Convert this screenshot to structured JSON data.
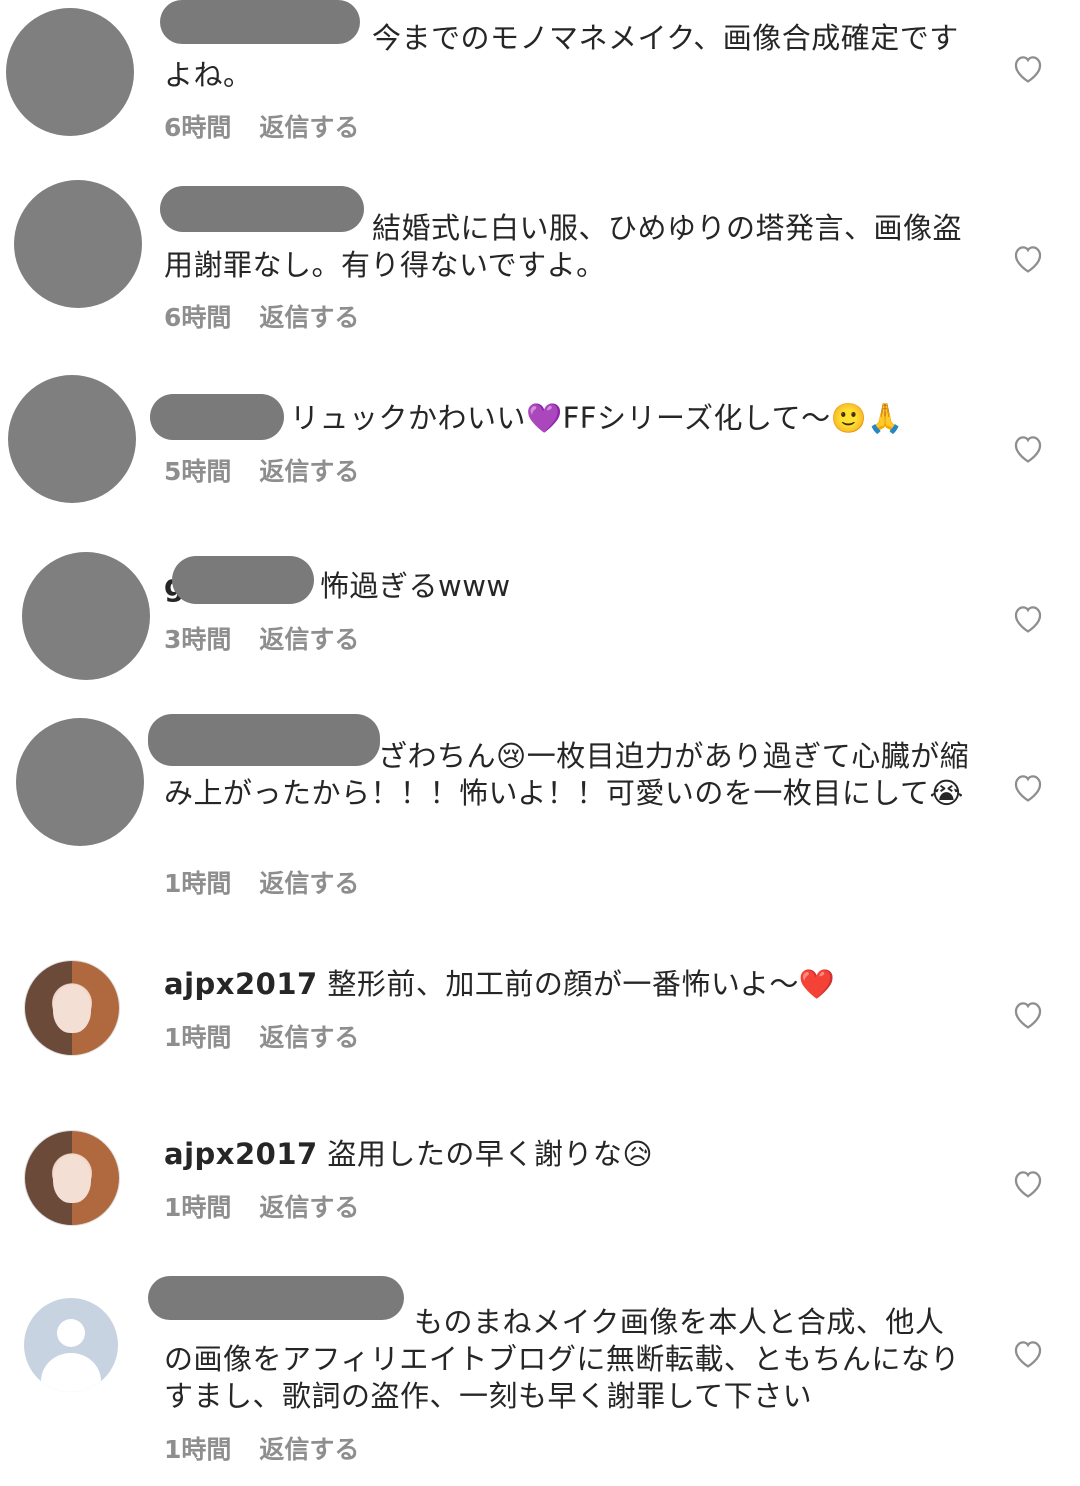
{
  "comments": [
    {
      "username": "",
      "text": "今までのモノマネメイク、画像合成確定ですよね。",
      "time": "6時間",
      "reply": "返信する"
    },
    {
      "username": "",
      "text": "結婚式に白い服、ひめゆりの塔発言、画像盗用謝罪なし。有り得ないですよ。",
      "time": "6時間",
      "reply": "返信する"
    },
    {
      "username": "",
      "text": "リュックかわいい💜FFシリーズ化して〜🙂🙏",
      "time": "5時間",
      "reply": "返信する"
    },
    {
      "username": "g",
      "text": "怖過ぎるwww",
      "time": "3時間",
      "reply": "返信する"
    },
    {
      "username": "",
      "text": "ざわちん😢一枚目迫力があり過ぎて心臓が縮み上がったから！！！怖いよ！！可愛いのを一枚目にして😭",
      "time": "1時間",
      "reply": "返信する"
    },
    {
      "username": "ajpx2017",
      "text": "整形前、加工前の顔が一番怖いよ〜❤️",
      "time": "1時間",
      "reply": "返信する"
    },
    {
      "username": "ajpx2017",
      "text": "盗用したの早く謝りな😥",
      "time": "1時間",
      "reply": "返信する"
    },
    {
      "username": "",
      "text": "ものまねメイク画像を本人と合成、他人の画像をアフィリエイトブログに無断転載、ともちんになりすまし、歌詞の盗作、一刻も早く謝罪して下さい",
      "time": "1時間",
      "reply": "返信する"
    }
  ],
  "icons": {
    "like": "heart-outline-icon"
  }
}
